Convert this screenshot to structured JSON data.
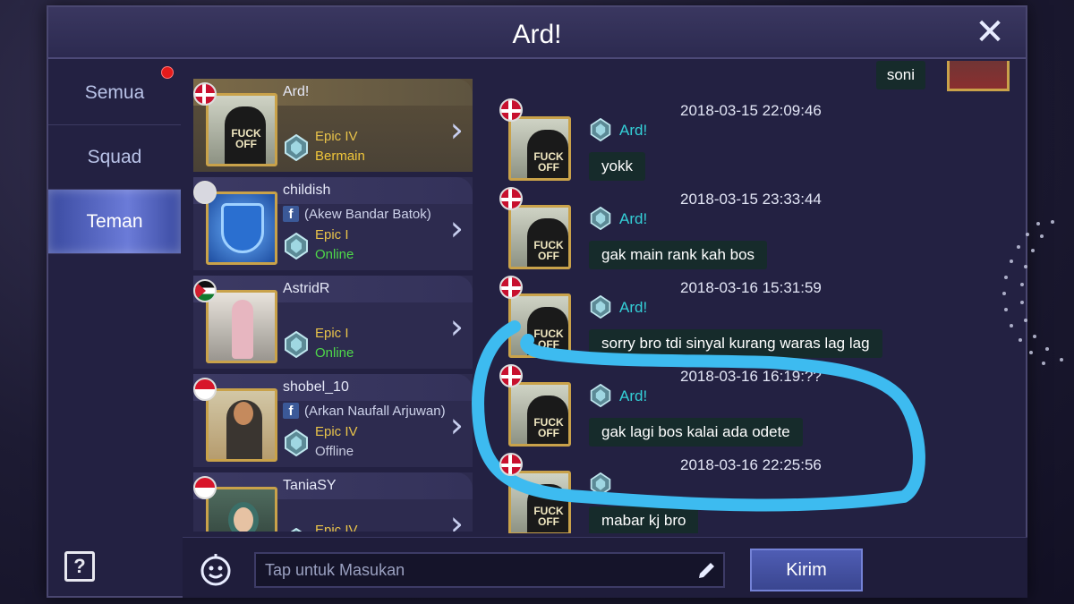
{
  "window": {
    "title": "Ard!"
  },
  "tabs": [
    {
      "label": "Semua",
      "notify": true
    },
    {
      "label": "Squad"
    },
    {
      "label": "Teman",
      "active": true
    }
  ],
  "friends": [
    {
      "name": "Ard!",
      "rank": "Epic IV",
      "status": "Bermain",
      "status_type": "playing",
      "flag": "dk"
    },
    {
      "name": "childish",
      "fb_name": "(Akew Bandar Batok)",
      "rank": "Epic I",
      "status": "Online",
      "status_type": "online",
      "flag": "none"
    },
    {
      "name": "AstridR",
      "rank": "Epic I",
      "status": "Online",
      "status_type": "online",
      "flag": "ps"
    },
    {
      "name": "shobel_10",
      "fb_name": "(Arkan Naufall Arjuwan)",
      "rank": "Epic IV",
      "status": "Offline",
      "status_type": "offline",
      "flag": "id"
    },
    {
      "name": "TaniaSY",
      "rank": "Epic IV",
      "flag": "id"
    }
  ],
  "chat": {
    "soni_message": "soni",
    "messages": [
      {
        "timestamp": "2018-03-15 22:09:46",
        "sender": "Ard!",
        "text": "yokk"
      },
      {
        "timestamp": "2018-03-15 23:33:44",
        "sender": "Ard!",
        "text": "gak main rank kah bos"
      },
      {
        "timestamp": "2018-03-16 15:31:59",
        "sender": "Ard!",
        "text": "sorry bro tdi sinyal kurang waras lag lag"
      },
      {
        "timestamp": "2018-03-16 16:19:??",
        "sender": "Ard!",
        "text": "gak lagi bos kalai ada odete"
      },
      {
        "timestamp": "2018-03-16 22:25:56",
        "sender": "",
        "text": "mabar kj bro"
      }
    ]
  },
  "input": {
    "placeholder": "Tap untuk Masukan",
    "send_label": "Kirim"
  },
  "colors": {
    "accent": "#34d1d8",
    "annotation": "#3dbbf0",
    "rank": "#e8c34a"
  }
}
